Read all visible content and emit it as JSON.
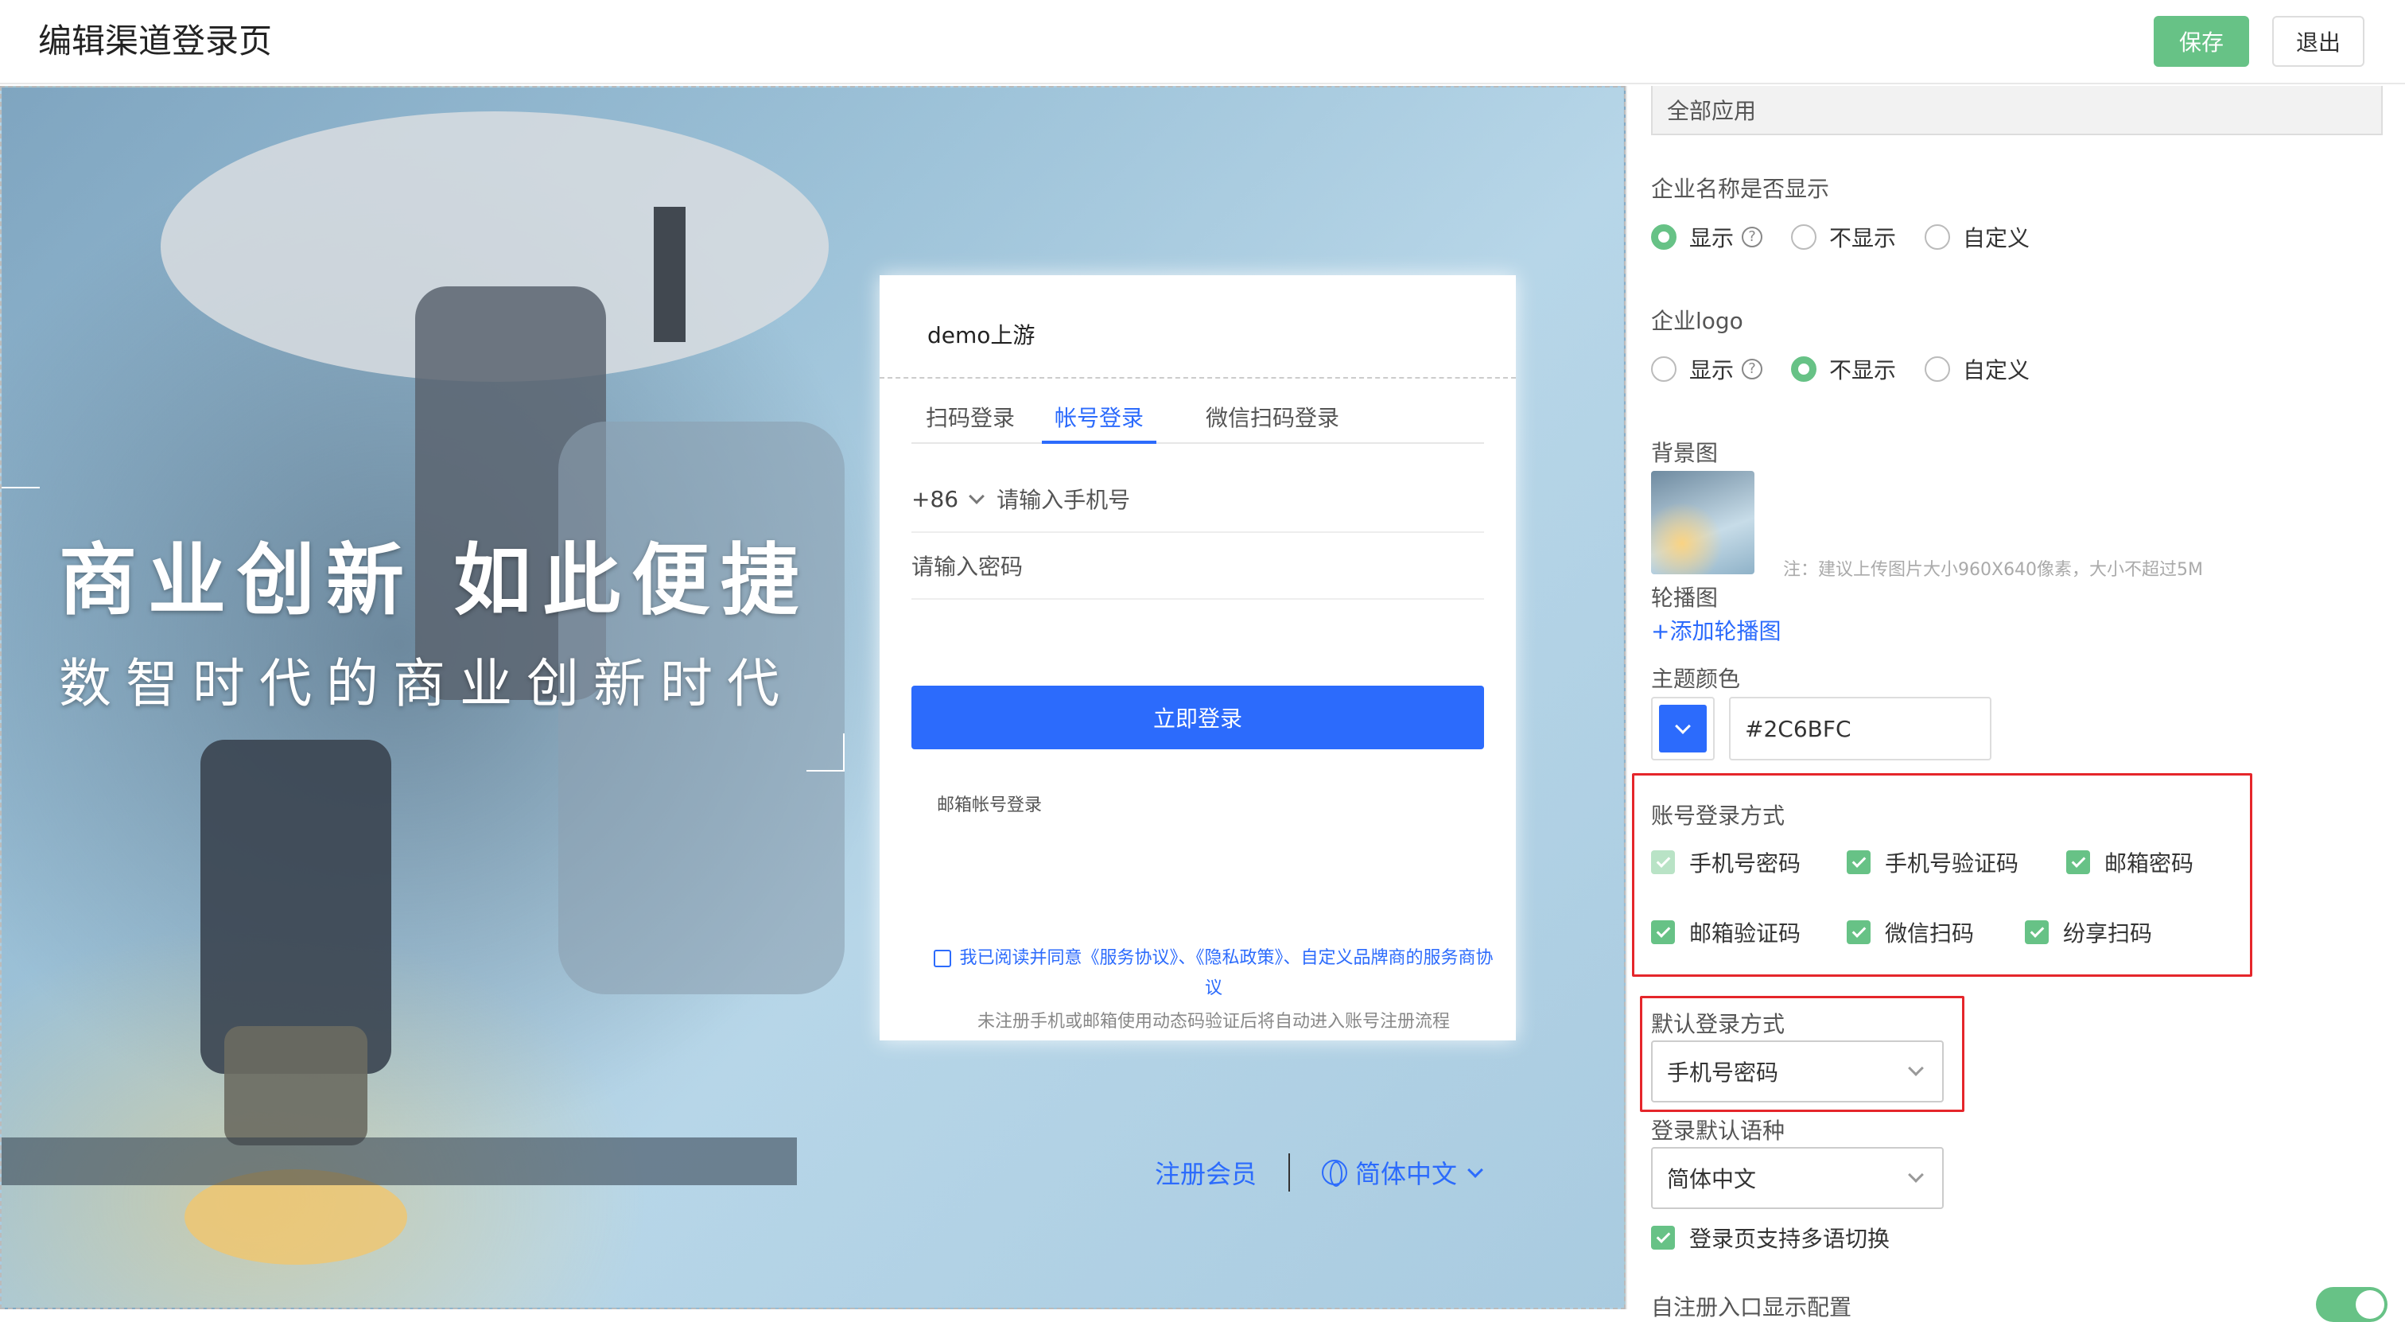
{
  "header": {
    "title": "编辑渠道登录页",
    "save_label": "保存",
    "exit_label": "退出"
  },
  "preview": {
    "headline": "商业创新 如此便捷",
    "subline": "数智时代的商业创新时代",
    "card": {
      "brand": "demo上游",
      "tabs": [
        "扫码登录",
        "帐号登录",
        "微信扫码登录"
      ],
      "active_tab": "帐号登录",
      "country_code": "+86",
      "phone_placeholder": "请输入手机号",
      "password_placeholder": "请输入密码",
      "login_button": "立即登录",
      "email_login": "邮箱帐号登录",
      "agreement": "我已阅读并同意《服务协议》、《隐私政策》、自定义品牌商的服务商协议",
      "notice": "未注册手机或邮箱使用动态码验证后将自动进入账号注册流程"
    },
    "footer": {
      "register": "注册会员",
      "language": "简体中文"
    }
  },
  "panel": {
    "app_scope": "全部应用",
    "company_name_label": "企业名称是否显示",
    "company_name_options": [
      "显示",
      "不显示",
      "自定义"
    ],
    "company_name_selected": "显示",
    "logo_label": "企业logo",
    "logo_options": [
      "显示",
      "不显示",
      "自定义"
    ],
    "logo_selected": "不显示",
    "background_label": "背景图",
    "background_note": "注：建议上传图片大小960X640像素，大小不超过5M",
    "carousel_label": "轮播图",
    "add_carousel": "+添加轮播图",
    "theme_color_label": "主题颜色",
    "theme_color": "#2C6BFC",
    "login_methods_label": "账号登录方式",
    "login_methods": [
      {
        "label": "手机号密码",
        "checked": true,
        "disabled": true
      },
      {
        "label": "手机号验证码",
        "checked": true
      },
      {
        "label": "邮箱密码",
        "checked": true
      },
      {
        "label": "邮箱验证码",
        "checked": true
      },
      {
        "label": "微信扫码",
        "checked": true
      },
      {
        "label": "纷享扫码",
        "checked": true
      }
    ],
    "default_method_label": "默认登录方式",
    "default_method": "手机号密码",
    "default_language_label": "登录默认语种",
    "default_language": "简体中文",
    "multi_language_label": "登录页支持多语切换",
    "self_register_label": "自注册入口显示配置"
  },
  "colors": {
    "accent": "#2C6BFC",
    "success": "#67C286",
    "highlight": "#E5262B"
  }
}
